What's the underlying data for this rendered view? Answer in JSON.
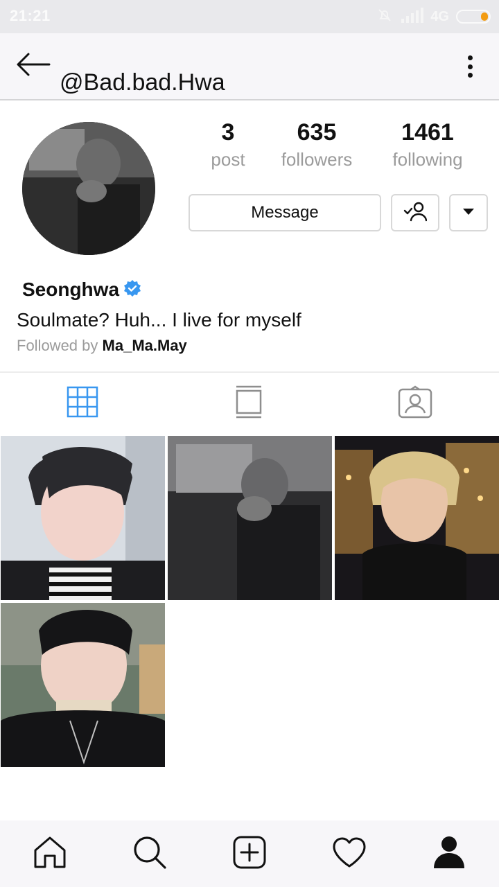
{
  "status_bar": {
    "time": "21:21",
    "network": "4G",
    "battery_color": "#f39c12"
  },
  "header": {
    "username": "@Bad.bad.Hwa",
    "back_icon": "arrow-left-icon",
    "menu_icon": "more-vertical-icon"
  },
  "profile": {
    "stats": [
      {
        "value": "3",
        "label": "post"
      },
      {
        "value": "635",
        "label": "followers"
      },
      {
        "value": "1461",
        "label": "following"
      }
    ],
    "message_label": "Message",
    "name": "Seonghwa",
    "verified_color": "#3897f0",
    "bio": "Soulmate? Huh... I live for myself",
    "followed_by_prefix": "Followed by",
    "followed_by_user": "Ma_Ma.May"
  },
  "tabs": [
    {
      "icon": "grid-icon",
      "active": true
    },
    {
      "icon": "feed-icon",
      "active": false
    },
    {
      "icon": "tagged-icon",
      "active": false
    }
  ],
  "grid": {
    "post_count": 4
  },
  "bottom_nav": [
    {
      "icon": "home-icon"
    },
    {
      "icon": "search-icon"
    },
    {
      "icon": "add-post-icon"
    },
    {
      "icon": "heart-icon"
    },
    {
      "icon": "profile-icon"
    }
  ],
  "colors": {
    "accent": "#3897f0",
    "muted_text": "#9b9b9b"
  }
}
